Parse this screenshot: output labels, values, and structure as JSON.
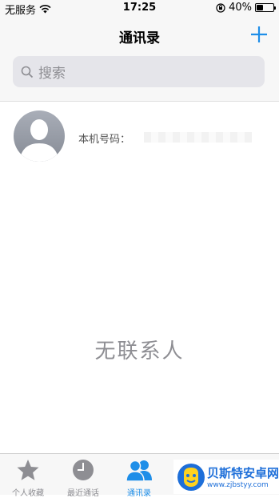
{
  "status_bar": {
    "carrier": "无服务",
    "time": "17:25",
    "battery": "40%",
    "battery_level": 0.4
  },
  "nav": {
    "title": "通讯录"
  },
  "search": {
    "placeholder": "搜索"
  },
  "my_card": {
    "label": "本机号码："
  },
  "empty_text": "无联系人",
  "tabs": [
    {
      "label": "个人收藏",
      "icon": "star-icon"
    },
    {
      "label": "最近通话",
      "icon": "clock-icon"
    },
    {
      "label": "通讯录",
      "icon": "contacts-icon",
      "active": true
    }
  ],
  "watermark": {
    "title": "贝斯特安卓网",
    "url": "www.zjbstyy.com"
  },
  "colors": {
    "accent": "#1e8ee8",
    "grey": "#8e8e93"
  }
}
